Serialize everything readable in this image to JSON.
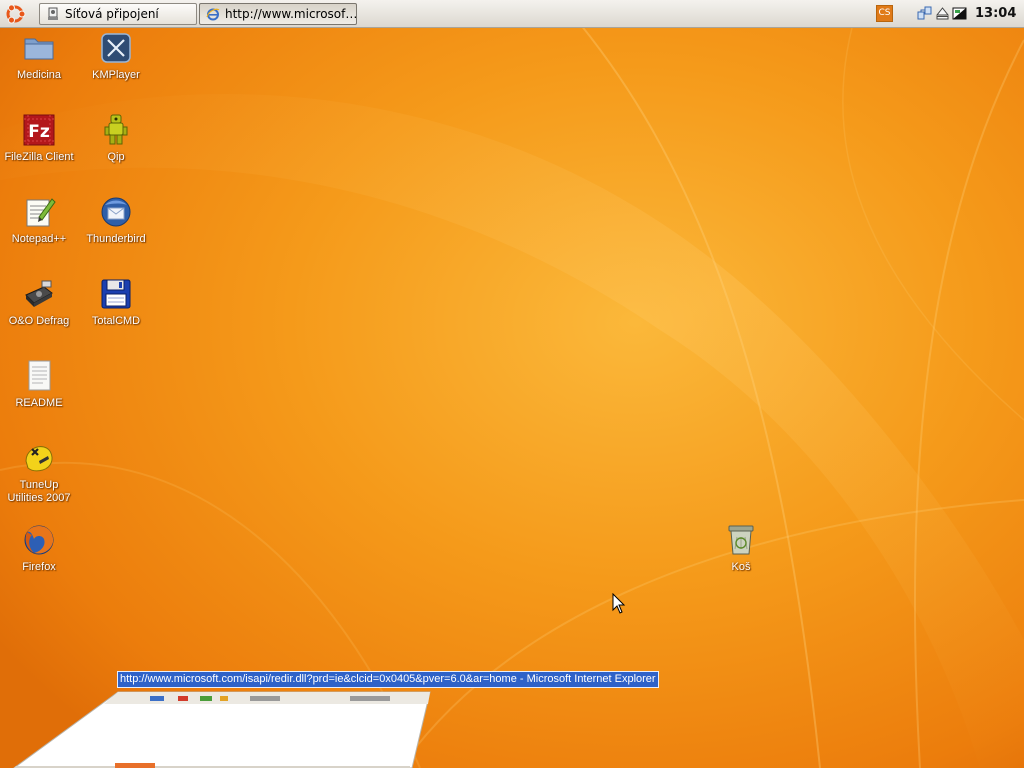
{
  "panel": {
    "tasks": [
      {
        "label": "Síťová připojení",
        "icon": "network-connections-icon"
      },
      {
        "label": "http://www.microsof…",
        "icon": "internet-explorer-icon"
      }
    ],
    "tray": {
      "language": "CS",
      "icons": [
        "network-status-icon",
        "eject-icon",
        "display-switch-icon"
      ]
    },
    "clock": "13:04"
  },
  "desktop": {
    "icons": [
      {
        "label": "Medicina",
        "icon": "folder-icon"
      },
      {
        "label": "KMPlayer",
        "icon": "kmplayer-icon"
      },
      {
        "label": "FileZilla Client",
        "icon": "filezilla-icon"
      },
      {
        "label": "Qip",
        "icon": "qip-icon"
      },
      {
        "label": "Notepad++",
        "icon": "notepad-plus-plus-icon"
      },
      {
        "label": "Thunderbird",
        "icon": "thunderbird-icon"
      },
      {
        "label": "O&O Defrag",
        "icon": "defrag-icon"
      },
      {
        "label": "TotalCMD",
        "icon": "totalcmd-floppy-icon"
      },
      {
        "label": "README",
        "icon": "text-file-icon"
      },
      {
        "label": "TuneUp Utilities 2007",
        "icon": "tuneup-icon"
      },
      {
        "label": "Firefox",
        "icon": "firefox-icon"
      },
      {
        "label": "Koš",
        "icon": "trash-icon"
      }
    ]
  },
  "window": {
    "title": "http://www.microsoft.com/isapi/redir.dll?prd=ie&clcid=0x0405&pver=6.0&ar=home - Microsoft Internet Explorer"
  },
  "colors": {
    "background": "#f08a10",
    "panel": "#e8e5df",
    "selection": "#2f62c8"
  }
}
